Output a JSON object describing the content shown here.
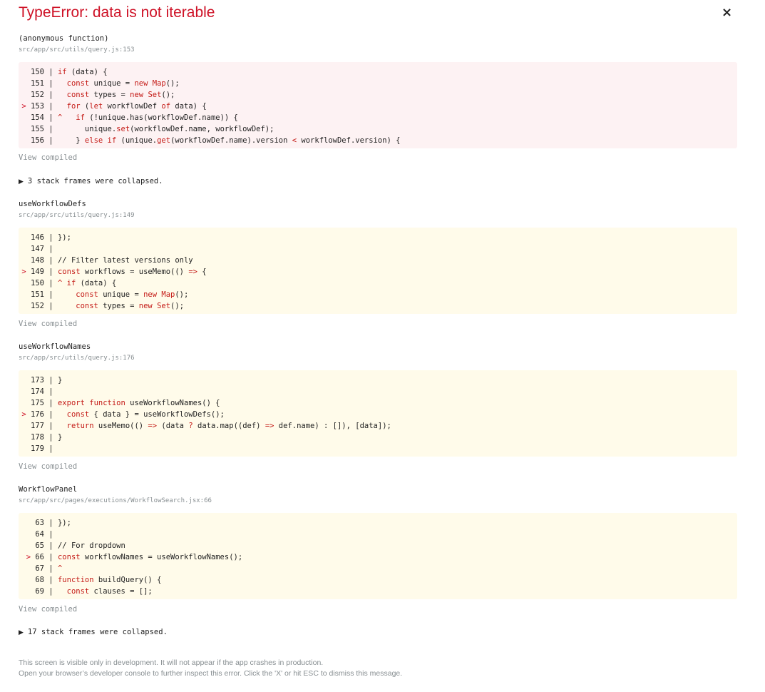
{
  "error": {
    "title": "TypeError: data is not iterable",
    "close_label": "×"
  },
  "frames": [
    {
      "name": "(anonymous function)",
      "location": "src/app/src/utils/query.js:153",
      "view_compiled": "View compiled"
    },
    {
      "name": "useWorkflowDefs",
      "location": "src/app/src/utils/query.js:149",
      "view_compiled": "View compiled"
    },
    {
      "name": "useWorkflowNames",
      "location": "src/app/src/utils/query.js:176",
      "view_compiled": "View compiled"
    },
    {
      "name": "WorkflowPanel",
      "location": "src/app/src/pages/executions/WorkflowSearch.jsx:66",
      "view_compiled": "View compiled"
    }
  ],
  "collapsed": [
    {
      "icon": "triangle-right-icon",
      "label": "3 stack frames were collapsed."
    },
    {
      "icon": "triangle-right-icon",
      "label": "17 stack frames were collapsed."
    }
  ],
  "footer": {
    "line1": "This screen is visible only in development. It will not appear if the app crashes in production.",
    "line2": "Open your browser’s developer console to further inspect this error.  Click the 'X' or hit ESC to dismiss this message."
  },
  "colors": {
    "error_red": "#ce1126",
    "error_bg": "#fdf2f3",
    "warn_bg": "#fffbea",
    "muted": "#878e91"
  }
}
